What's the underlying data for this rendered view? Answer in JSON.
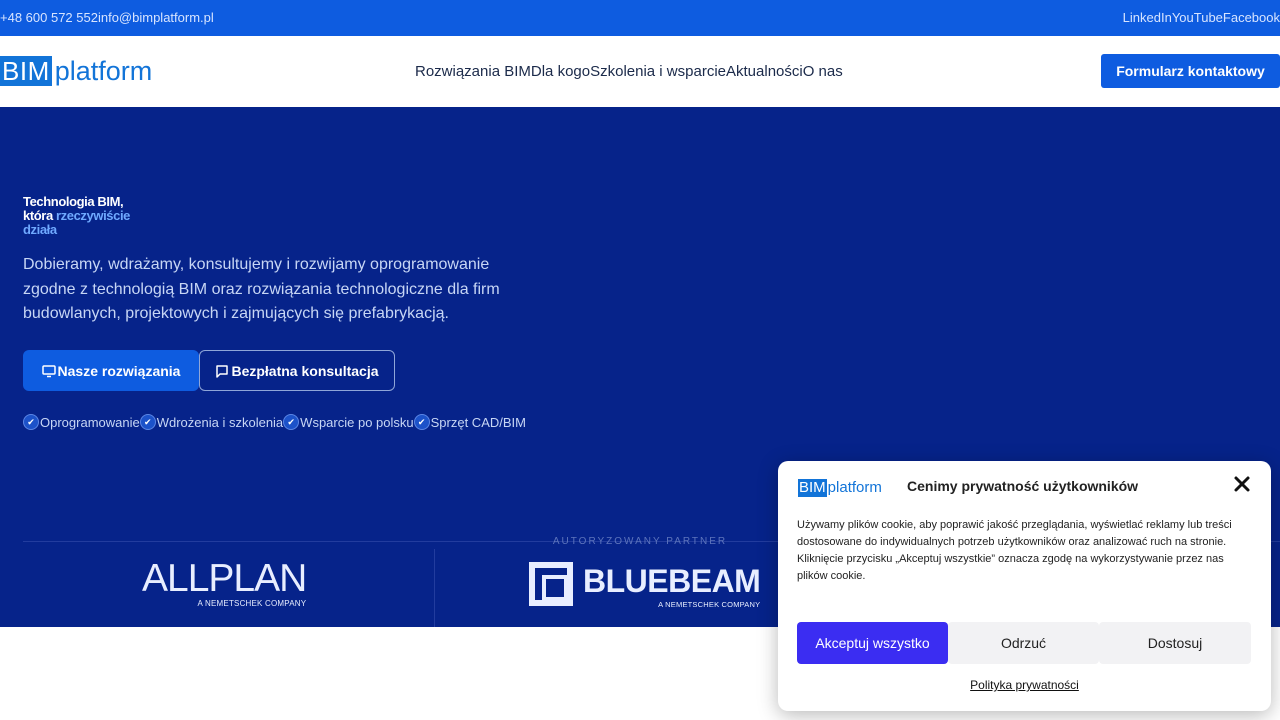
{
  "topbar": {
    "phone": "+48 600 572 552",
    "email": "info@bimplatform.pl",
    "social": [
      "LinkedIn",
      "YouTube",
      "Facebook"
    ]
  },
  "nav": {
    "logo_box": "BIM",
    "logo_text": "platform",
    "menu": [
      "Rozwiązania BIM",
      "Dla kogo",
      "Szkolenia i wsparcie",
      "Aktualności",
      "O nas"
    ],
    "cta": "Formularz kontaktowy"
  },
  "hero": {
    "title_1": "Technologia BIM,",
    "title_2": "która ",
    "title_highlight": "rzeczywiście działa",
    "description": "Dobieramy, wdrażamy, konsultujemy i rozwijamy oprogramowanie zgodne z technologią BIM oraz rozwiązania technologiczne dla firm budowlanych, projektowych i zajmujących się prefabrykacją.",
    "primary_button": "Nasze rozwiązania",
    "secondary_button": "Bezpłatna konsultacja",
    "features": [
      "Oprogramowanie",
      "Wdrożenia i szkolenia",
      "Wsparcie po polsku",
      "Sprzęt CAD/BIM"
    ],
    "partner_label": "AUTORYZOWANY PARTNER",
    "partners": [
      {
        "name": "ALLPLAN",
        "sub": "A NEMETSCHEK COMPANY"
      },
      {
        "name": "BLUEBEAM",
        "sub": "A NEMETSCHEK COMPANY"
      }
    ]
  },
  "cookie": {
    "logo_box": "BIM",
    "logo_text": "platform",
    "title": "Cenimy prywatność użytkowników",
    "text": "Używamy plików cookie, aby poprawić jakość przeglądania, wyświetlać reklamy lub treści dostosowane do indywidualnych potrzeb użytkowników oraz analizować ruch na stronie. Kliknięcie przycisku „Akceptuj wszystkie” oznacza zgodę na wykorzystywanie przez nas plików cookie.",
    "accept": "Akceptuj wszystko",
    "deny": "Odrzuć",
    "customize": "Dostosuj",
    "policy": "Polityka prywatności"
  },
  "colors": {
    "topbar": "#0e5ce0",
    "hero_bg": "#06238a",
    "accent": "#0e5ce0",
    "highlight": "#6fa9ff",
    "cookie_accept": "#3b2df2"
  }
}
